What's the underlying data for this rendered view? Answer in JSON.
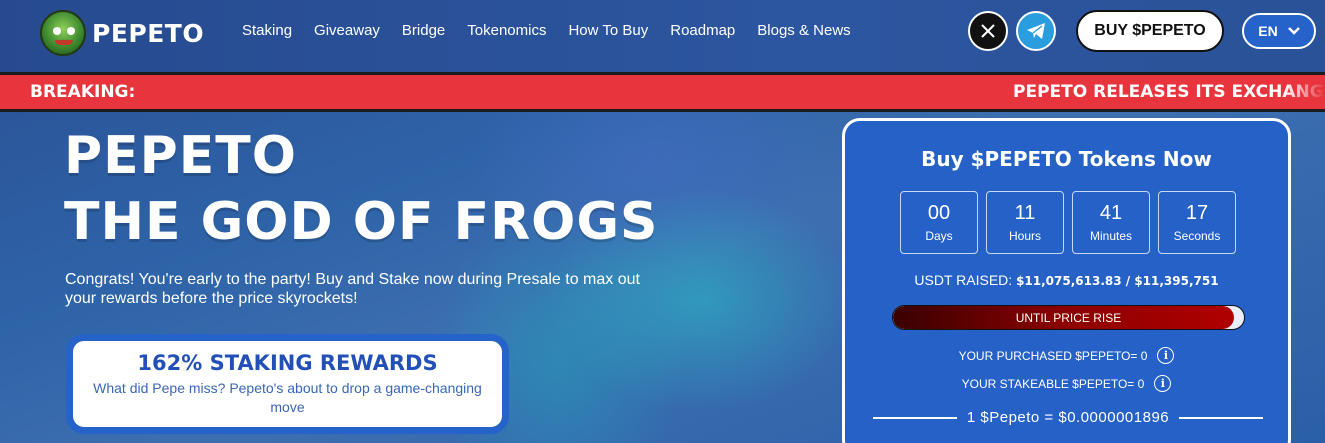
{
  "brand": {
    "name": "PEPETO"
  },
  "nav": {
    "items": [
      {
        "label": "Staking"
      },
      {
        "label": "Giveaway"
      },
      {
        "label": "Bridge"
      },
      {
        "label": "Tokenomics"
      },
      {
        "label": "How To Buy"
      },
      {
        "label": "Roadmap"
      },
      {
        "label": "Blogs & News"
      }
    ]
  },
  "header": {
    "social": [
      {
        "icon": "x-icon"
      },
      {
        "icon": "telegram-icon"
      }
    ],
    "buy_label": "BUY $PEPETO",
    "language": "EN"
  },
  "ticker": {
    "label": "BREAKING:",
    "text": "PEPETO RELEASES ITS EXCHANGE"
  },
  "hero": {
    "title_line1": "PEPETO",
    "title_line2": "THE GOD OF FROGS",
    "subtitle": "Congrats! You're early to the party! Buy and Stake now during Presale to max out your rewards before the price skyrockets!",
    "staking_card": {
      "title": "162% STAKING REWARDS",
      "description": "What did Pepe miss? Pepeto's about to drop a game-changing move"
    }
  },
  "buy_panel": {
    "title": "Buy $PEPETO Tokens Now",
    "countdown": [
      {
        "value": "00",
        "unit": "Days"
      },
      {
        "value": "11",
        "unit": "Hours"
      },
      {
        "value": "41",
        "unit": "Minutes"
      },
      {
        "value": "17",
        "unit": "Seconds"
      }
    ],
    "raised_label": "USDT RAISED:",
    "raised_value": "$11,075,613.83 / $11,395,751",
    "progress_fraction": 0.972,
    "progress_label": "UNTIL PRICE RISE",
    "purchased_text": "YOUR PURCHASED $PEPETO= 0",
    "stakeable_text": "YOUR STAKEABLE $PEPETO= 0",
    "rate_text": "1 $Pepeto = $0.0000001896"
  },
  "colors": {
    "accent_blue": "#2562c9",
    "breaking_red": "#e8343d",
    "progress_fill": "#8b0000"
  }
}
